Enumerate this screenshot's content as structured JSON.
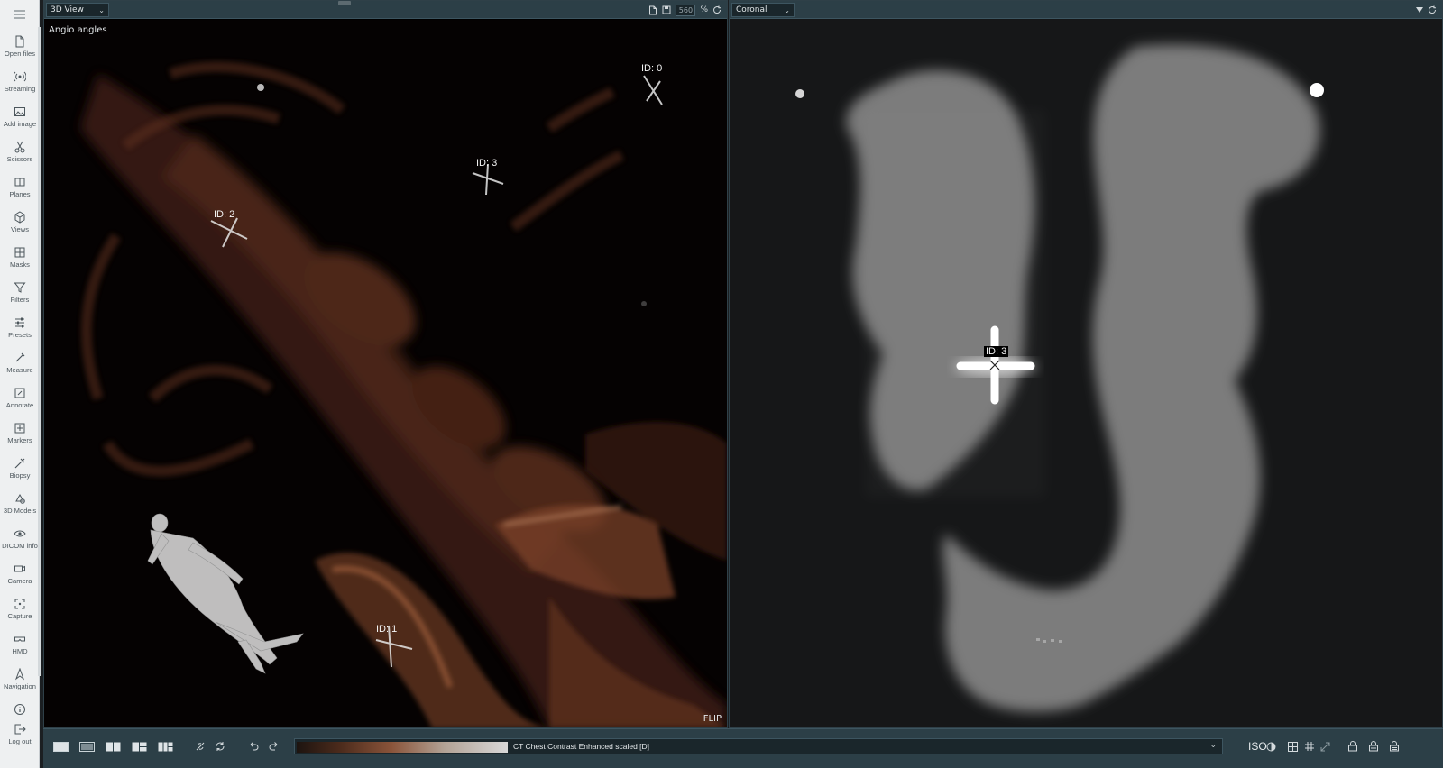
{
  "sidebar": {
    "menu_icon": "hamburger-icon",
    "items": [
      {
        "label": "Open files",
        "icon": "file-icon"
      },
      {
        "label": "Streaming",
        "icon": "streaming-icon"
      },
      {
        "label": "Add image",
        "icon": "image-icon"
      },
      {
        "label": "Scissors",
        "icon": "scissors-icon"
      },
      {
        "label": "Planes",
        "icon": "planes-icon"
      },
      {
        "label": "Views",
        "icon": "cube-icon"
      },
      {
        "label": "Masks",
        "icon": "grid-icon"
      },
      {
        "label": "Filters",
        "icon": "filter-icon"
      },
      {
        "label": "Presets",
        "icon": "sliders-icon"
      },
      {
        "label": "Measure",
        "icon": "ruler-icon"
      },
      {
        "label": "Annotate",
        "icon": "annotate-icon"
      },
      {
        "label": "Markers",
        "icon": "marker-icon"
      },
      {
        "label": "Biopsy",
        "icon": "needle-icon"
      },
      {
        "label": "3D Models",
        "icon": "models-icon"
      },
      {
        "label": "DICOM info",
        "icon": "eye-icon"
      },
      {
        "label": "Camera",
        "icon": "camera-icon"
      },
      {
        "label": "Capture",
        "icon": "capture-icon"
      },
      {
        "label": "HMD",
        "icon": "hmd-icon"
      },
      {
        "label": "Navigation",
        "icon": "navigation-icon"
      },
      {
        "label": "",
        "icon": "info-icon"
      },
      {
        "label": "Log out",
        "icon": "logout-icon"
      }
    ]
  },
  "left_view": {
    "selected": "3D View",
    "zoom_value": "560",
    "zoom_unit": "%",
    "overlay_label": "Angio angles",
    "flip_label": "FLIP",
    "markers": [
      "ID: 0",
      "ID: 3",
      "ID: 2",
      "ID: 1"
    ]
  },
  "right_view": {
    "selected": "Coronal",
    "marker": "ID: 3"
  },
  "bottombar": {
    "dataset_name": "CT Chest Contrast Enhanced scaled [D]",
    "iso_label": "ISO"
  },
  "colors": {
    "header": "#2c3f47",
    "sidebar": "#eef0f1",
    "volume_tint": "#8a4a2e"
  }
}
